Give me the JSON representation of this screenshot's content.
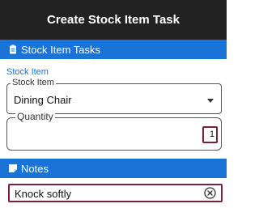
{
  "window": {
    "title": "Create Stock Item Task"
  },
  "sections": {
    "stock_tasks": {
      "label": "Stock Item Tasks",
      "icon": "clipboard-icon"
    },
    "notes": {
      "label": "Notes",
      "icon": "note-icon"
    }
  },
  "stock_item": {
    "group_label": "Stock Item",
    "field_legend": "Stock Item",
    "value": "Dining Chair"
  },
  "quantity": {
    "legend": "Quantity",
    "value": "1"
  },
  "notes": {
    "value": "Knock softly"
  },
  "colors": {
    "title_bar": "#222222",
    "section_bar": "#1a73d6",
    "focus_border": "#7a1f3d"
  }
}
